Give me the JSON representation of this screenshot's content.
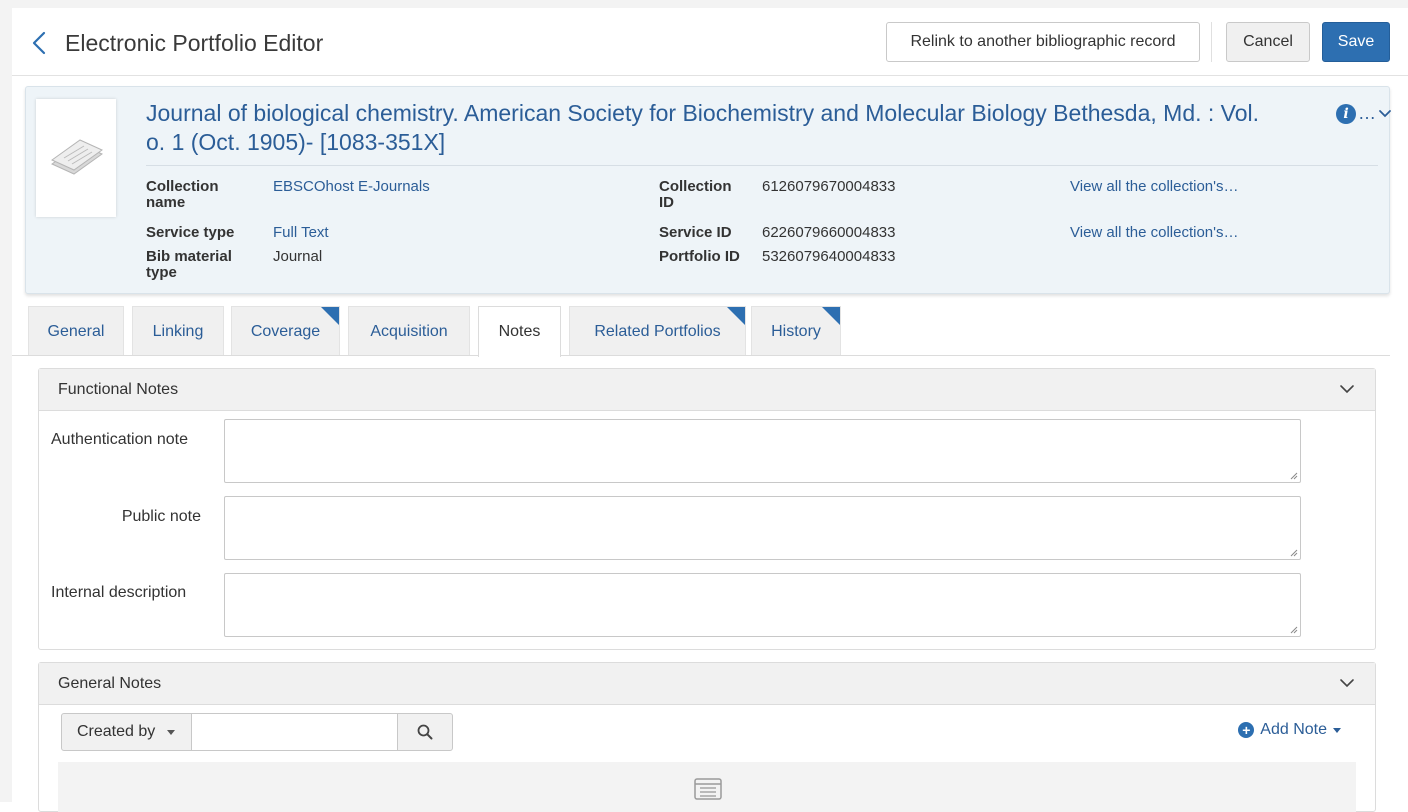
{
  "header": {
    "title": "Electronic Portfolio Editor",
    "relink_label": "Relink to another bibliographic record",
    "cancel_label": "Cancel",
    "save_label": "Save"
  },
  "record": {
    "title": "Journal of biological chemistry. American Society for Biochemistry and Molecular Biology Bethesda, Md. : Vol. 1, no. 1 (Oct. 1905)- [1083-351X]",
    "title_line1": "Journal of biological chemistry. American Society for Biochemistry and Molecular Biology Bethesda, Md. : Vol.",
    "title_line2": "o. 1 (Oct. 1905)- [1083-351X]",
    "truncation": "…",
    "fields": {
      "collection_name_label": "Collection name",
      "collection_name_value": "EBSCOhost E-Journals",
      "service_type_label": "Service type",
      "service_type_value": "Full Text",
      "bib_material_type_label": "Bib material type",
      "bib_material_type_value": "Journal",
      "collection_id_label": "Collection ID",
      "collection_id_value": "6126079670004833",
      "service_id_label": "Service ID",
      "service_id_value": "6226079660004833",
      "portfolio_id_label": "Portfolio ID",
      "portfolio_id_value": "5326079640004833",
      "view_all_1": "View all the collection's…",
      "view_all_2": "View all the collection's…"
    }
  },
  "tabs": [
    {
      "label": "General",
      "flag": false,
      "active": false
    },
    {
      "label": "Linking",
      "flag": false,
      "active": false
    },
    {
      "label": "Coverage",
      "flag": true,
      "active": false
    },
    {
      "label": "Acquisition",
      "flag": false,
      "active": false
    },
    {
      "label": "Notes",
      "flag": false,
      "active": true
    },
    {
      "label": "Related Portfolios",
      "flag": true,
      "active": false
    },
    {
      "label": "History",
      "flag": true,
      "active": false
    }
  ],
  "functional_notes": {
    "title": "Functional Notes",
    "authentication_note_label": "Authentication note",
    "authentication_note_value": "",
    "public_note_label": "Public note",
    "public_note_value": "",
    "internal_description_label": "Internal description",
    "internal_description_value": ""
  },
  "general_notes": {
    "title": "General Notes",
    "filter_label": "Created by",
    "filter_value": "",
    "add_note_label": "Add Note"
  },
  "colors": {
    "accent": "#2d6fb1",
    "link": "#2b5d97",
    "card_bg": "#eef4f8"
  }
}
